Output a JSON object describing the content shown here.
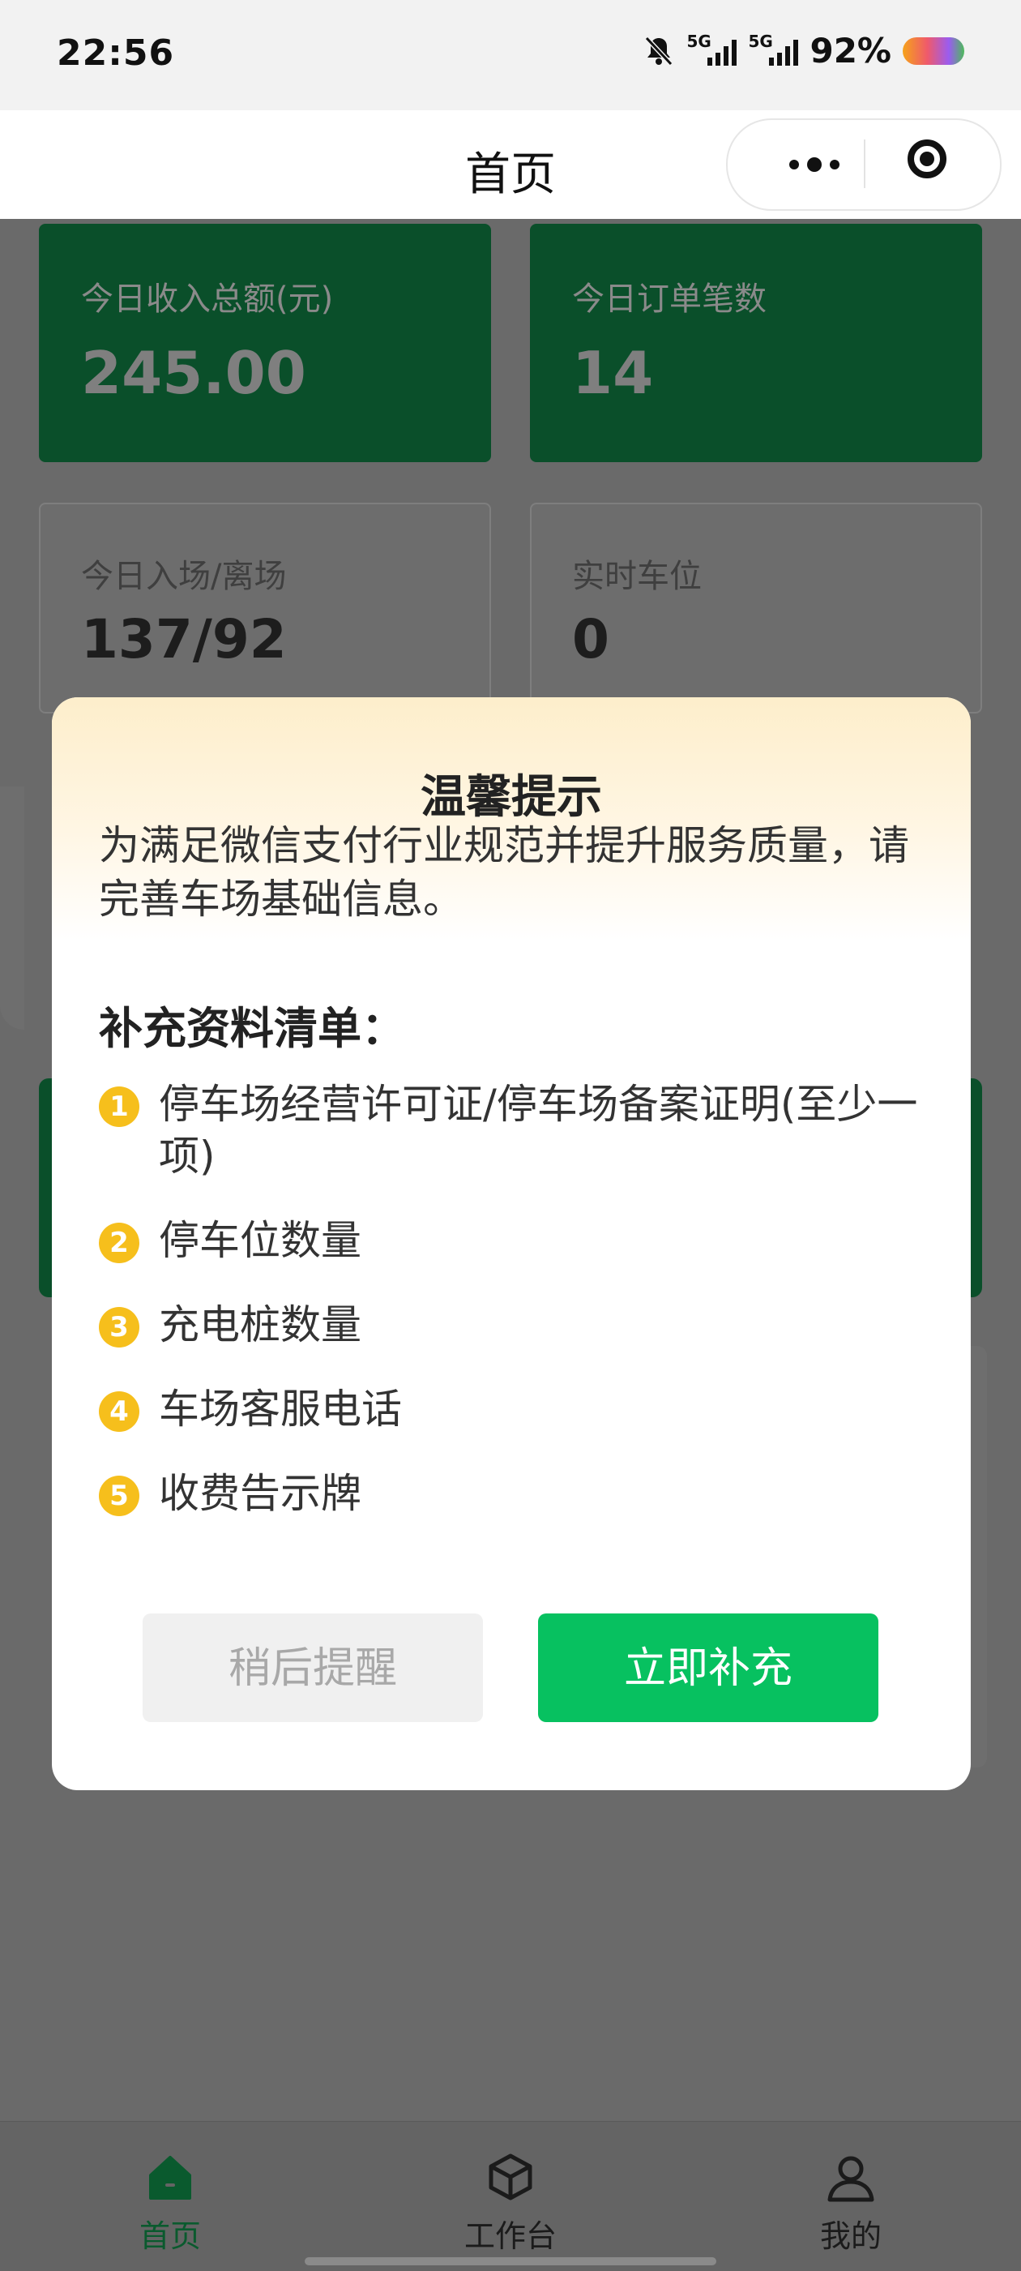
{
  "status_bar": {
    "time": "22:56",
    "signal1_label": "5G",
    "signal2_label": "5G",
    "battery": "92%",
    "icons": [
      "bell-off-icon",
      "signal-icon",
      "signal-icon",
      "battery-icon"
    ]
  },
  "header": {
    "title": "首页",
    "icons": [
      "more-dots-icon",
      "target-icon"
    ]
  },
  "stats": {
    "income_label": "今日收入总额(元)",
    "income_value": "245.00",
    "orders_label": "今日订单笔数",
    "orders_value": "14",
    "inout_label": "今日入场/离场",
    "inout_value": "137/92",
    "spots_label": "实时车位",
    "spots_value": "0"
  },
  "dialog": {
    "title": "温馨提示",
    "message": "为满足微信支付行业规范并提升服务质量，请完善车场基础信息。",
    "list_title": "补充资料清单：",
    "items": [
      {
        "num": "1",
        "text": "停车场经营许可证/停车场备案证明(至少一项)"
      },
      {
        "num": "2",
        "text": "停车位数量"
      },
      {
        "num": "3",
        "text": "充电桩数量"
      },
      {
        "num": "4",
        "text": "车场客服电话"
      },
      {
        "num": "5",
        "text": "收费告示牌"
      }
    ],
    "later_button": "稍后提醒",
    "now_button": "立即补充",
    "accent_color": "#07c160",
    "number_badge_color": "#f6bf1c"
  },
  "tabbar": {
    "tabs": [
      {
        "label": "首页",
        "icon": "home-icon",
        "active": true
      },
      {
        "label": "工作台",
        "icon": "cube-icon",
        "active": false
      },
      {
        "label": "我的",
        "icon": "user-icon",
        "active": false
      }
    ]
  }
}
